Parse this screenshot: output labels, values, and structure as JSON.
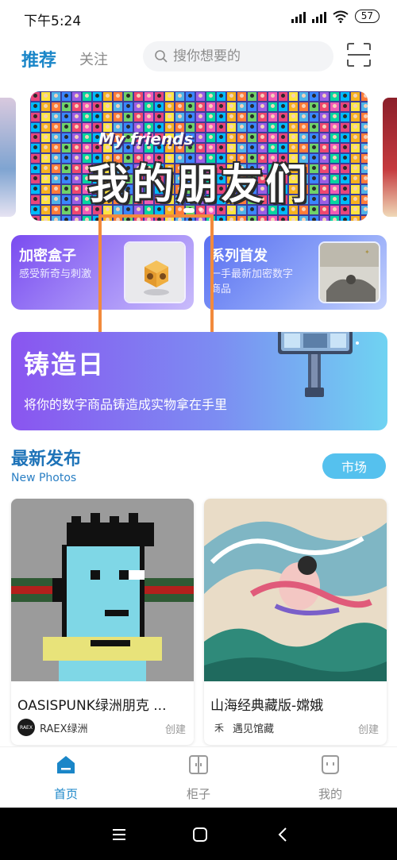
{
  "status": {
    "time": "下午5:24",
    "battery": "57"
  },
  "header": {
    "tab_recommend": "推荐",
    "tab_follow": "关注",
    "search_placeholder": "搜你想要的"
  },
  "banner": {
    "title": "我的朋友们",
    "subtitle": "My friends"
  },
  "categories": [
    {
      "title": "加密盒子",
      "desc": "感受新奇与刺激"
    },
    {
      "title": "系列首发",
      "desc": "一手最新加密数字商品"
    }
  ],
  "forge": {
    "title": "铸造日",
    "desc": "将你的数字商品铸造成实物拿在手里"
  },
  "section": {
    "title": "最新发布",
    "subtitle": "New Photos",
    "market_label": "市场"
  },
  "products": [
    {
      "name": "OASISPUNK绿洲朋克 ...",
      "author": "RAEX绿洲",
      "avatar_text": "RAEX",
      "created_label": "创建"
    },
    {
      "name": "山海经典藏版-嫦娥",
      "author": "遇见馆藏",
      "avatar_text": "⽲",
      "created_label": "创建"
    }
  ],
  "bottom_nav": [
    {
      "label": "首页",
      "icon": "home-icon",
      "active": true
    },
    {
      "label": "柜子",
      "icon": "cabinet-icon",
      "active": false
    },
    {
      "label": "我的",
      "icon": "profile-icon",
      "active": false
    }
  ],
  "colors": {
    "accent": "#1a86c8",
    "highlight": "#f28a3c",
    "market": "#55c1ee"
  }
}
